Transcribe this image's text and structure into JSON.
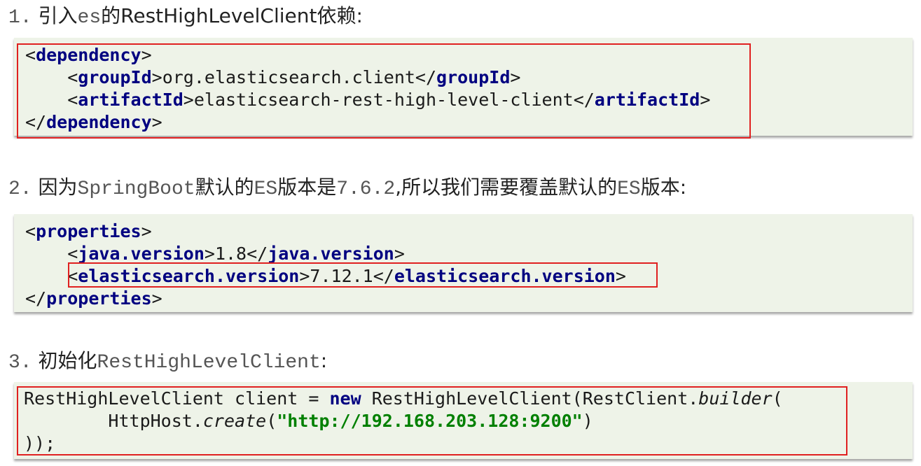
{
  "step1": {
    "num": "1.",
    "pre": "引入",
    "mono": "es",
    "post": "的RestHighLevelClient依赖:"
  },
  "block1": {
    "line1_open": "<",
    "line1_tag": "dependency",
    "line1_close": ">",
    "line2_open": "<",
    "line2_tag": "groupId",
    "line2_mid": ">org.elasticsearch.client</",
    "line2_tag2": "groupId",
    "line2_close": ">",
    "line3_open": "<",
    "line3_tag": "artifactId",
    "line3_mid": ">elasticsearch-rest-high-level-client</",
    "line3_tag2": "artifactId",
    "line3_close": ">",
    "line4_open": "</",
    "line4_tag": "dependency",
    "line4_close": ">"
  },
  "step2": {
    "num": "2.",
    "a": "因为",
    "b": "SpringBoot",
    "c": "默认的",
    "d": "ES",
    "e": "版本是",
    "f": "7.6.2",
    "g": ",所以我们需要覆盖默认的",
    "h": "ES",
    "i": "版本:"
  },
  "block2": {
    "line1_open": "<",
    "line1_tag": "properties",
    "line1_close": ">",
    "line2_open": "<",
    "line2_tag": "java.version",
    "line2_mid": ">1.8</",
    "line2_tag2": "java.version",
    "line2_close": ">",
    "line3_open": "<",
    "line3_tag": "elasticsearch.version",
    "line3_mid": ">7.12.1</",
    "line3_tag2": "elasticsearch.version",
    "line3_close": ">",
    "line4_open": "</",
    "line4_tag": "properties",
    "line4_close": ">"
  },
  "step3": {
    "num": "3.",
    "pre": "初始化",
    "mono": "RestHighLevelClient",
    "post": ":"
  },
  "block3": {
    "line1_a": "RestHighLevelClient client = ",
    "line1_new": "new",
    "line1_b": " RestHighLevelClient(RestClient.",
    "line1_builder": "builder",
    "line1_c": "(",
    "line2_a": "        HttpHost.",
    "line2_create": "create",
    "line2_b": "(",
    "line2_str": "\"http://192.168.203.128:9200\"",
    "line2_c": ")",
    "line3": "));"
  },
  "colors": {
    "code_bg": "#eef3e8",
    "keyword": "#000080",
    "string": "#008000",
    "highlight_border": "#e02020"
  }
}
